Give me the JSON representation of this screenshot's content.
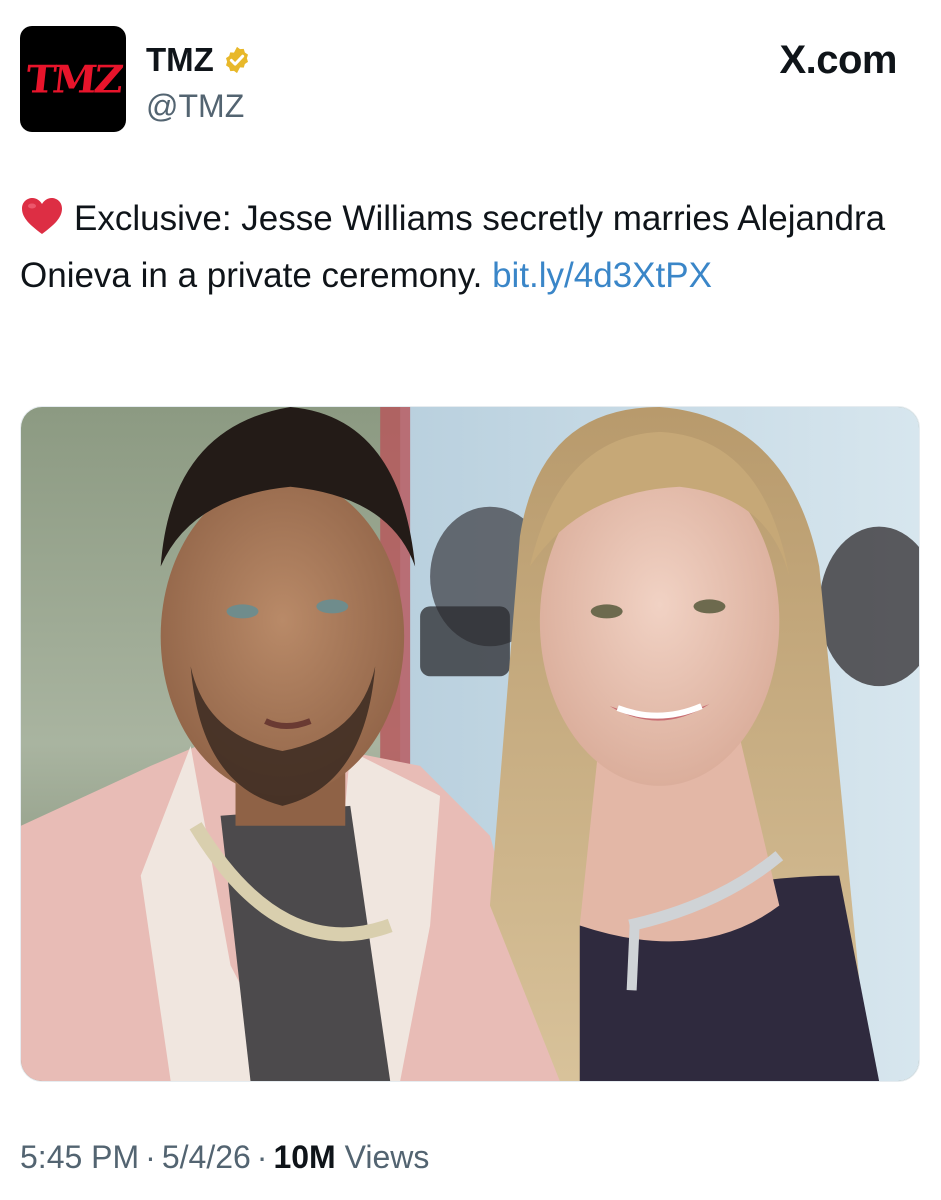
{
  "account": {
    "avatar_logo_text": "TMZ",
    "display_name": "TMZ",
    "handle": "@TMZ",
    "verified_badge_color": "#e8b82a"
  },
  "brand": {
    "site_label": "X.com"
  },
  "tweet": {
    "emoji": "heart-icon",
    "text": "Exclusive: Jesse Williams secretly marries Alejandra Onieva in a private ceremony.",
    "link": "bit.ly/4d3XtPX",
    "link_color": "#3a86c8"
  },
  "media": {
    "icon": "photo"
  },
  "footer": {
    "time": "5:45 PM",
    "date": "5/4/26",
    "views_count": "10M",
    "views_label": "Views",
    "separator": "·"
  }
}
